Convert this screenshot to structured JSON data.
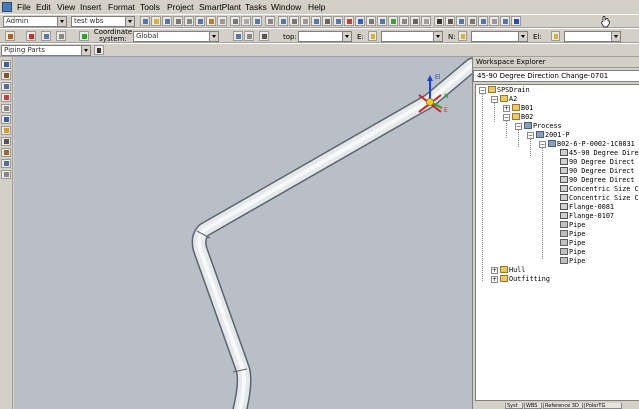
{
  "menu": [
    "File",
    "Edit",
    "View",
    "Insert",
    "Format",
    "Tools",
    "Project",
    "SmartPlant",
    "Tasks",
    "Window",
    "Help"
  ],
  "toolbar1": {
    "user_combo": "Admin",
    "wbs_combo": "test wbs"
  },
  "toolbar2": {
    "coordinate_label": "Coordinate system:",
    "coordinate_value": "Global",
    "top_label": "top:",
    "e_label": "E:",
    "n_label": "N:",
    "el_label": "El:"
  },
  "toolbar3": {
    "locate_filter": "Piping Parts"
  },
  "explorer": {
    "title": "Workspace Explorer",
    "path": "45-90 Degree Direction Change-0701",
    "tree": [
      {
        "label": "SPSDrain",
        "icon": "folder"
      },
      {
        "label": "A2",
        "icon": "folder"
      },
      {
        "label": "B01",
        "icon": "folder"
      },
      {
        "label": "B02",
        "icon": "folder"
      },
      {
        "label": "Process",
        "icon": "sys"
      },
      {
        "label": "2001-P",
        "icon": "sys"
      },
      {
        "label": "B02-6-P-0002-1C0031",
        "icon": "sys"
      },
      {
        "label": "45-90 Degree Direc",
        "icon": "comp"
      },
      {
        "label": "90 Degree Direct",
        "icon": "comp"
      },
      {
        "label": "90 Degree Direct",
        "icon": "comp"
      },
      {
        "label": "90 Degree Direct",
        "icon": "comp"
      },
      {
        "label": "Concentric Size C",
        "icon": "comp"
      },
      {
        "label": "Concentric Size C",
        "icon": "comp"
      },
      {
        "label": "Flange-0081",
        "icon": "comp"
      },
      {
        "label": "Flange-0107",
        "icon": "comp"
      },
      {
        "label": "Pipe",
        "icon": "pipe"
      },
      {
        "label": "Pipe",
        "icon": "pipe"
      },
      {
        "label": "Pipe",
        "icon": "pipe"
      },
      {
        "label": "Pipe",
        "icon": "pipe"
      },
      {
        "label": "Pipe",
        "icon": "pipe"
      },
      {
        "label": "Hull",
        "icon": "folder"
      },
      {
        "label": "Outfitting",
        "icon": "folder"
      }
    ],
    "tabs": [
      "Syst",
      "WBS",
      "Reference 3D",
      "PolerTG"
    ]
  },
  "gizmo": {
    "x_label": "E",
    "y_label": "N",
    "z_label": "El"
  },
  "colors": {
    "viewport_bg": "#b9bfc7",
    "pipe_fill": "#e6e8ea",
    "pipe_edge": "#5a6470",
    "axis_x": "#d02020",
    "axis_y": "#20a020",
    "axis_z": "#2040d0"
  }
}
